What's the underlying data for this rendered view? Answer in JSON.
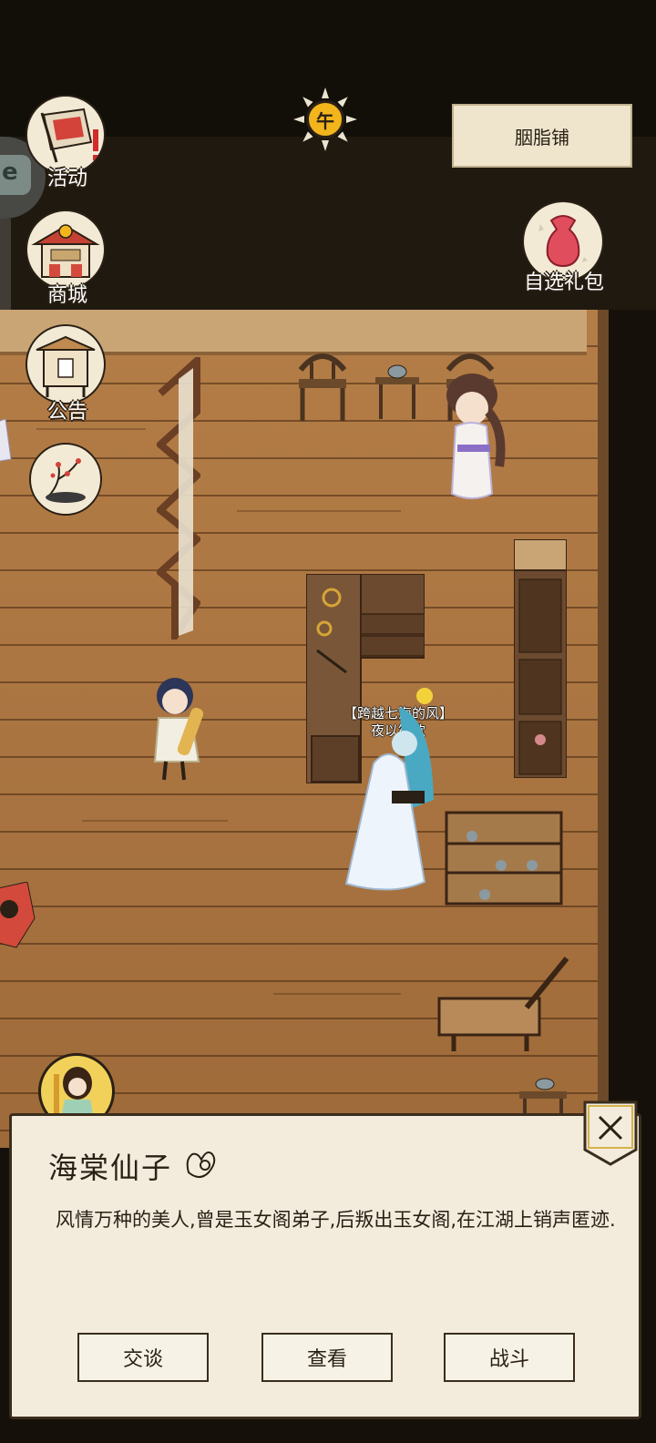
{
  "hud": {
    "time_glyph": "午",
    "location_name": "胭脂铺"
  },
  "left_menu": [
    {
      "label": "活动",
      "icon": "banner-flag-icon"
    },
    {
      "label": "商城",
      "icon": "shop-building-icon"
    },
    {
      "label": "公告",
      "icon": "notice-board-icon"
    },
    {
      "label": "",
      "icon": "plum-blossom-painting-icon"
    }
  ],
  "right_menu": {
    "gift_label": "自选礼包"
  },
  "scene": {
    "player_title": "【跨越七海的风】",
    "player_name": "夜以笙歌"
  },
  "dialog": {
    "npc_name": "海棠仙子",
    "description": "风情万种的美人,曾是玉女阁弟子,后叛出玉女阁,在江湖上销声匿迹.",
    "buttons": [
      "交谈",
      "查看",
      "战斗"
    ]
  },
  "colors": {
    "wood": "#b07843",
    "ink": "#2a2015",
    "paper": "#f3ecdd",
    "sun": "#f2b51c"
  }
}
